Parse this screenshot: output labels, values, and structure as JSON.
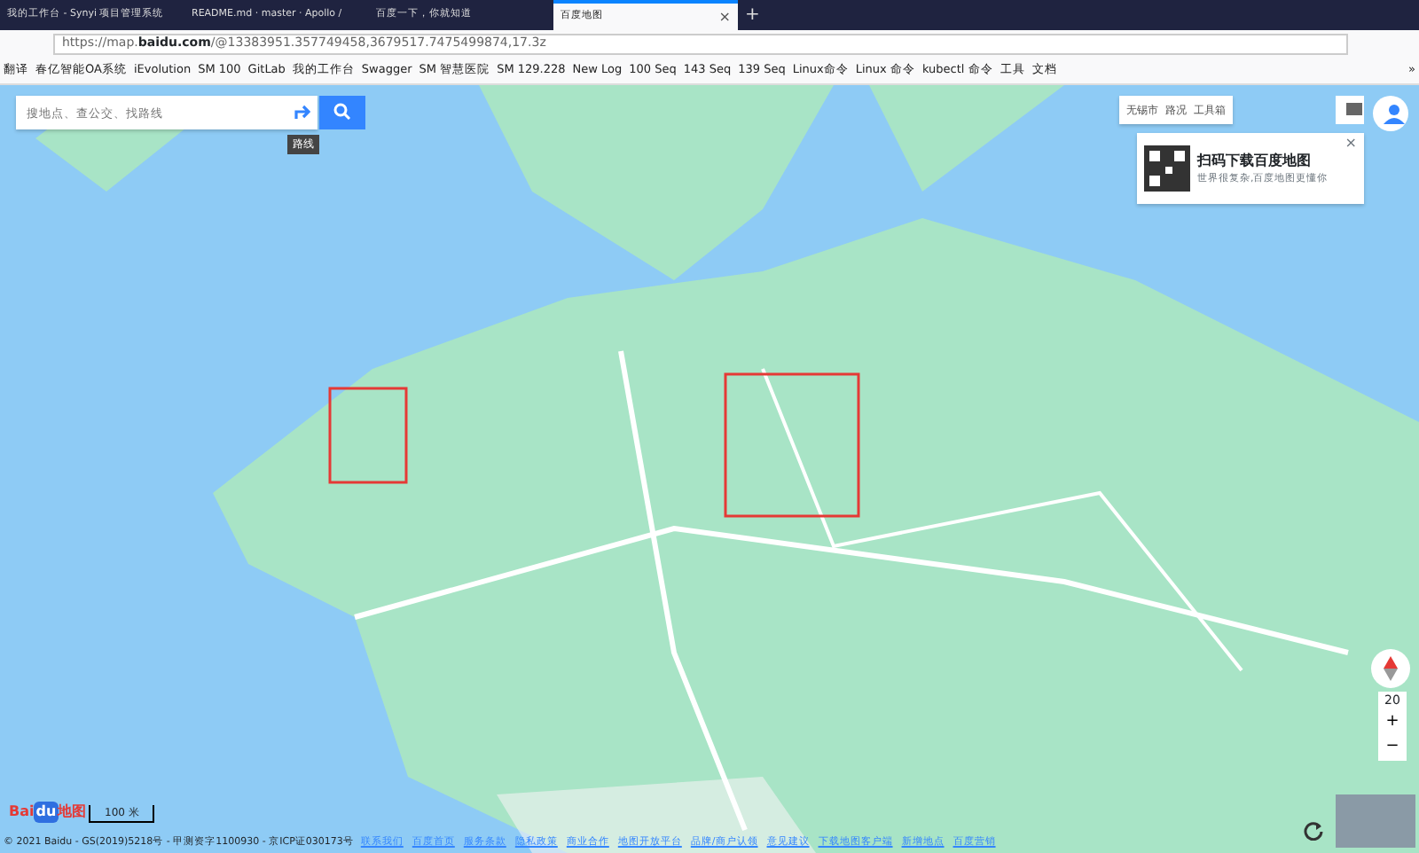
{
  "browser": {
    "tabs": [
      {
        "title": "我的工作台 - Synyi 项目管理系统",
        "selected": false
      },
      {
        "title": "README.md · master · Apollo /",
        "selected": false
      },
      {
        "title": "百度一下，你就知道",
        "selected": false
      },
      {
        "title": "百度地图",
        "selected": true
      }
    ],
    "url_prefix": "https://map.",
    "url_domain": "baidu.com",
    "url_rest": "/@13383951.357749458,3679517.7475499874,17.3z",
    "bookmarks": [
      "翻译",
      "春亿智能OA系统",
      "iEvolution",
      "SM 100",
      "GitLab",
      "我的工作台",
      "Swagger",
      "SM 智慧医院",
      "SM 129.228",
      "New Log",
      "100 Seq",
      "143 Seq",
      "139 Seq",
      "Linux命令",
      "Linux 命令",
      "kubectl 命令",
      "工具",
      "文档"
    ],
    "overflow": "»",
    "tab_close": "×",
    "new_tab": "+"
  },
  "map": {
    "search": {
      "placeholder": "搜地点、查公交、找路线"
    },
    "route_tooltip": "路线",
    "city": "无锡市",
    "traffic": "路况",
    "toolbox": "工具箱",
    "promo": {
      "title": "扫码下载百度地图",
      "subtitle": "世界很复杂,百度地图更懂你",
      "close": "×"
    },
    "zoom": {
      "level": "20",
      "plus": "+",
      "minus": "−"
    },
    "logo": {
      "latin": "Bai",
      "mid": "du",
      "cn": "地图"
    },
    "scale": "100 米",
    "copyright": "© 2021 Baidu - GS(2019)5218号 - 甲测资字1100930 - 京ICP证030173号",
    "footer_links": [
      "联系我们",
      "百度首页",
      "服务条款",
      "隐私政策",
      "商业合作",
      "地图开放平台",
      "品牌/商户认领",
      "意见建议",
      "下载地图客户端",
      "新增地点",
      "百度营销"
    ]
  }
}
